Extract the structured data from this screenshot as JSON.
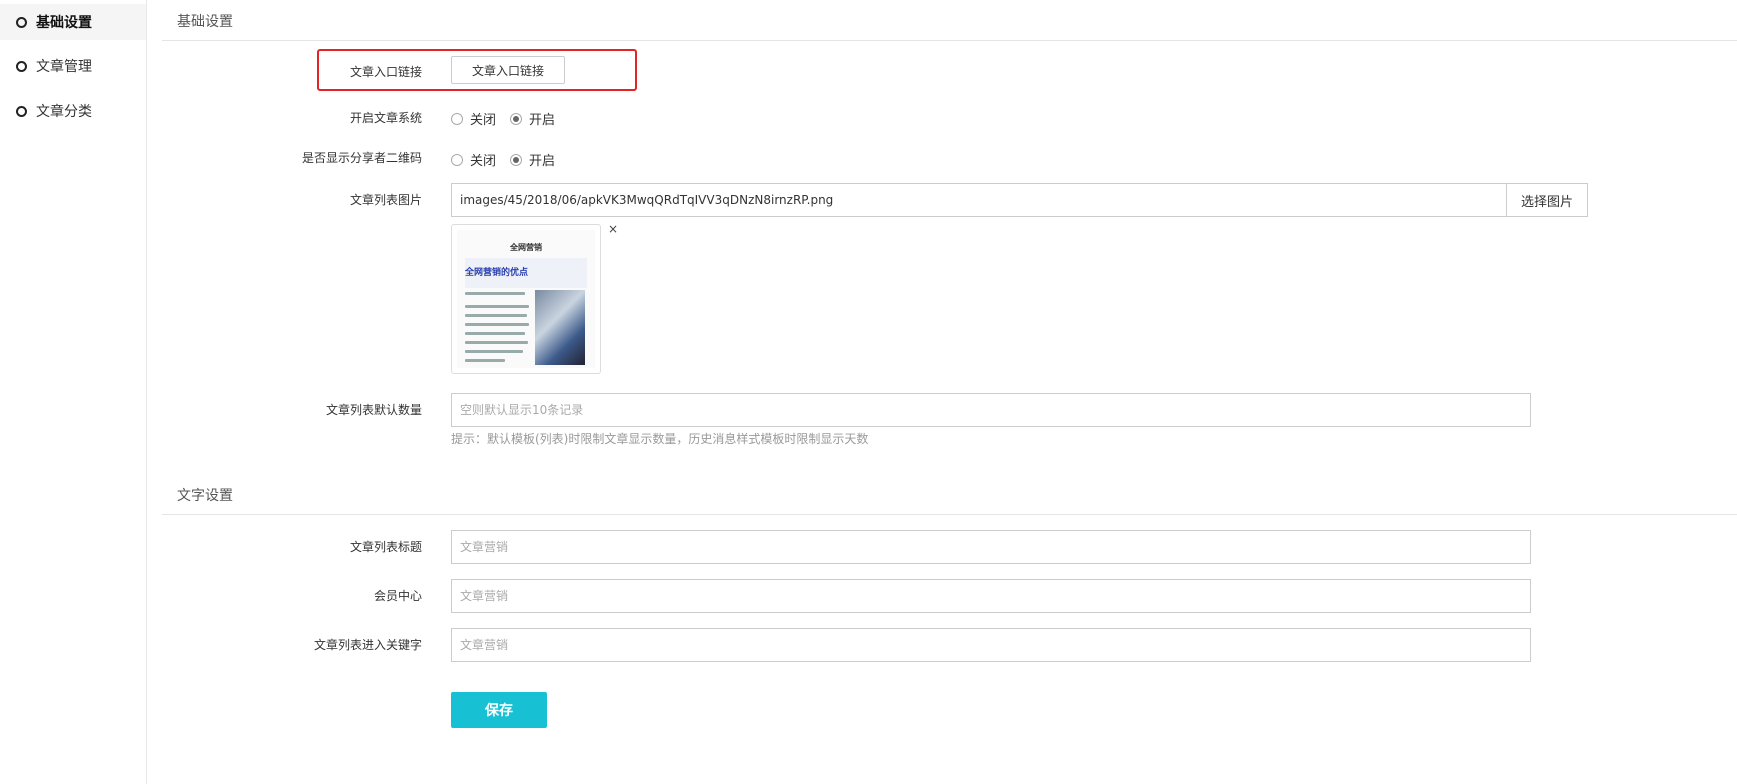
{
  "sidebar": {
    "items": [
      {
        "label": "基础设置",
        "active": true
      },
      {
        "label": "文章管理",
        "active": false
      },
      {
        "label": "文章分类",
        "active": false
      }
    ]
  },
  "basic": {
    "section_title": "基础设置",
    "entry_link": {
      "label": "文章入口链接",
      "button": "文章入口链接"
    },
    "article_system": {
      "label": "开启文章系统",
      "options": [
        "关闭",
        "开启"
      ],
      "selected": "开启"
    },
    "show_qrcode": {
      "label": "是否显示分享者二维码",
      "options": [
        "关闭",
        "开启"
      ],
      "selected": "开启"
    },
    "list_image": {
      "label": "文章列表图片",
      "value": "images/45/2018/06/apkVK3MwqQRdTqIVV3qDNzN8irnzRP.png",
      "select_button": "选择图片",
      "remove": "×",
      "thumbnail": {
        "title": "全网营销",
        "heading": "全网营销的优点"
      }
    },
    "default_count": {
      "label": "文章列表默认数量",
      "placeholder": "空则默认显示10条记录",
      "hint": "提示：默认模板(列表)时限制文章显示数量，历史消息样式模板时限制显示天数"
    }
  },
  "text": {
    "section_title": "文字设置",
    "list_title": {
      "label": "文章列表标题",
      "placeholder": "文章营销"
    },
    "member_center": {
      "label": "会员中心",
      "placeholder": "文章营销"
    },
    "keyword": {
      "label": "文章列表进入关键字",
      "placeholder": "文章营销"
    }
  },
  "save_label": "保存",
  "colors": {
    "accent": "#17c1d3",
    "highlight": "#e42424"
  }
}
